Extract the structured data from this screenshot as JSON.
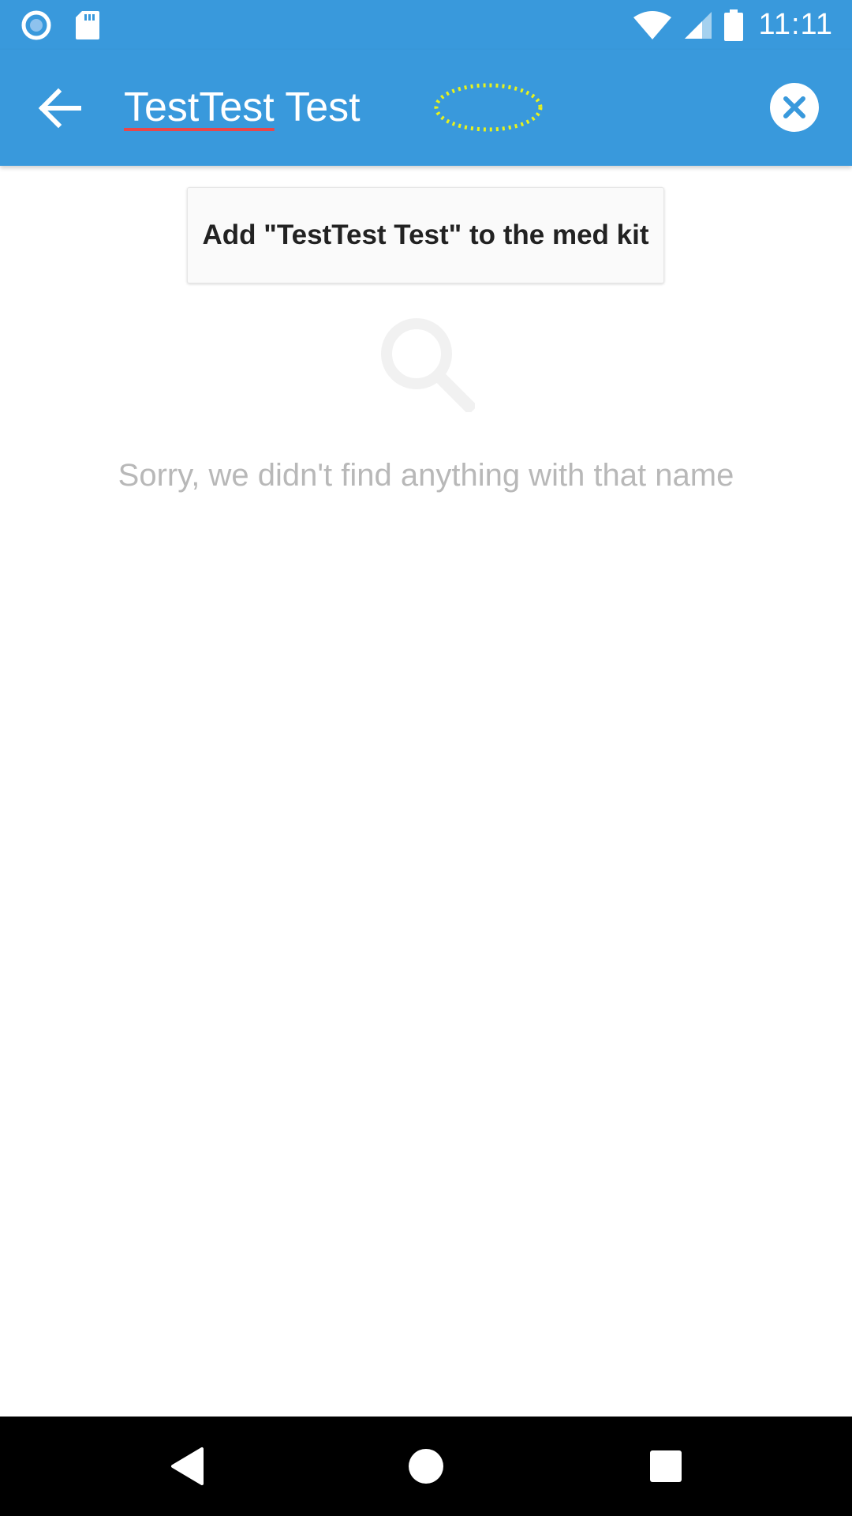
{
  "status_bar": {
    "time": "11:11",
    "left_icons": [
      "record-icon",
      "sd-card-icon"
    ],
    "right_icons": [
      "wifi-icon",
      "cell-signal-icon",
      "battery-icon"
    ]
  },
  "toolbar": {
    "search_value_misspelled": "TestTest",
    "search_value_rest": " Test",
    "icons": {
      "back": "arrow-back-icon",
      "clear": "close-circle-icon"
    }
  },
  "content": {
    "add_button_label": "Add \"TestTest Test\" to the med kit",
    "empty_message": "Sorry, we didn't find anything with that name",
    "empty_icon": "search-icon"
  },
  "nav_bar": {
    "icons": [
      "back-triangle-icon",
      "home-circle-icon",
      "recents-square-icon"
    ]
  },
  "colors": {
    "primary": "#3999dc",
    "spellcheck_underline": "#e8474b",
    "muted_text": "#b8b8b8",
    "loading_indicator": "#e8f21c"
  }
}
